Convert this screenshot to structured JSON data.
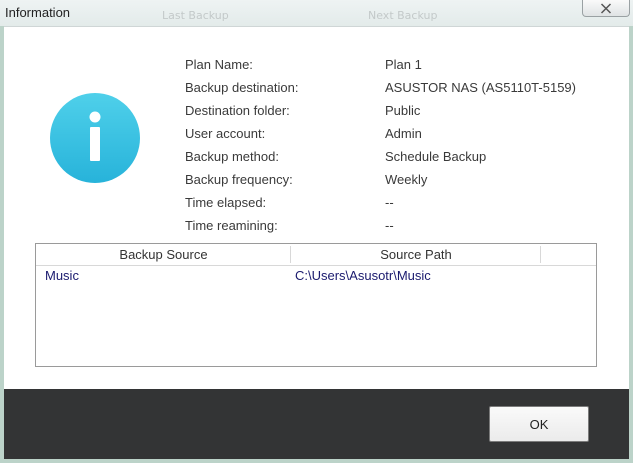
{
  "window": {
    "title": "Information",
    "background_tabs": [
      "Last Backup",
      "Next Backup"
    ]
  },
  "icon": {
    "name": "info-icon",
    "color": "#36bfe0"
  },
  "details": [
    {
      "label": "Plan Name:",
      "value": "Plan 1"
    },
    {
      "label": "Backup destination:",
      "value": "ASUSTOR NAS (AS5110T-5159)"
    },
    {
      "label": "Destination folder:",
      "value": "Public"
    },
    {
      "label": "User account:",
      "value": "Admin"
    },
    {
      "label": "Backup method:",
      "value": "Schedule Backup"
    },
    {
      "label": "Backup frequency:",
      "value": "Weekly"
    },
    {
      "label": "Time elapsed:",
      "value": "--"
    },
    {
      "label": "Time reamining:",
      "value": "--"
    }
  ],
  "table": {
    "columns": [
      "Backup Source",
      "Source Path"
    ],
    "rows": [
      {
        "source": "Music",
        "path": "C:\\Users\\Asusotr\\Music"
      }
    ]
  },
  "footer": {
    "ok_label": "OK",
    "background": "#333435"
  }
}
